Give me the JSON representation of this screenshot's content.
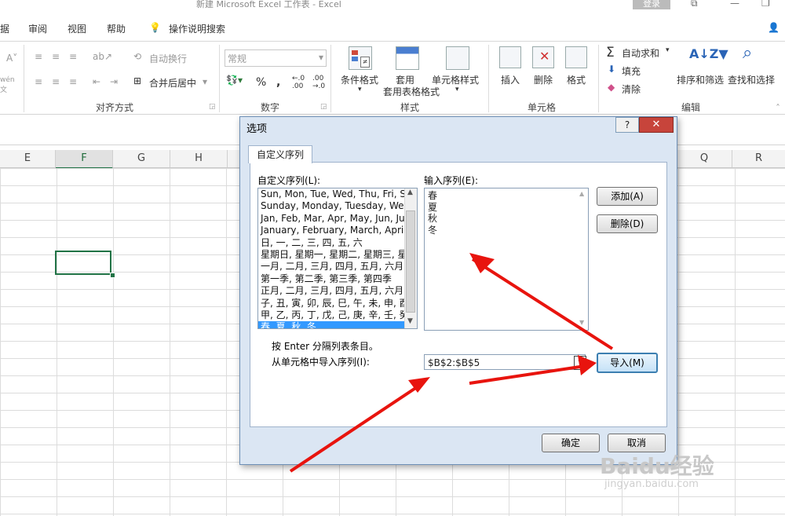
{
  "title_bar": {
    "title": "新建 Microsoft Excel 工作表 - Excel",
    "login_label": "登录"
  },
  "ribbon_tabs": [
    "据",
    "审阅",
    "视图",
    "帮助",
    "操作说明搜索"
  ],
  "ribbon": {
    "alignment": {
      "wrap_label": "自动换行",
      "merge_label": "合并后居中",
      "group_label": "对齐方式"
    },
    "number": {
      "format_value": "常规",
      "percent": "%",
      "comma": ",",
      "group_label": "数字"
    },
    "styles": {
      "conditional_label": "条件格式",
      "table_label": "套用表格格式",
      "cell_styles_label": "单元格样式",
      "group_label": "样式"
    },
    "cells": {
      "insert_label": "插入",
      "delete_label": "删除",
      "format_label": "格式",
      "group_label": "单元格"
    },
    "editing": {
      "autosum_label": "自动求和",
      "fill_label": "填充",
      "clear_label": "清除",
      "sort_label": "排序和筛选",
      "find_label": "查找和选择",
      "group_label": "编辑"
    }
  },
  "columns": [
    "E",
    "F",
    "G",
    "H",
    "Q",
    "R"
  ],
  "dialog": {
    "title": "选项",
    "help_label": "?",
    "close_label": "✕",
    "tab_label": "自定义序列",
    "custom_lists_label": "自定义序列(L):",
    "custom_lists": [
      "Sun, Mon, Tue, Wed, Thu, Fri, S",
      "Sunday, Monday, Tuesday, Wed",
      "Jan, Feb, Mar, Apr, May, Jun, Ju",
      "January, February, March, April",
      "日, 一, 二, 三, 四, 五, 六",
      "星期日, 星期一, 星期二, 星期三, 星",
      "一月, 二月, 三月, 四月, 五月, 六月,",
      "第一季, 第二季, 第三季, 第四季",
      "正月, 二月, 三月, 四月, 五月, 六月,",
      "子, 丑, 寅, 卯, 辰, 巳, 午, 未, 申, 酉",
      "甲, 乙, 丙, 丁, 戊, 己, 庚, 辛, 壬, 癸",
      "春, 夏, 秋, 冬"
    ],
    "entries_label": "输入序列(E):",
    "entries": [
      "春",
      "夏",
      "秋",
      "冬"
    ],
    "add_label": "添加(A)",
    "delete_label": "删除(D)",
    "hint": "按 Enter 分隔列表条目。",
    "import_label": "从单元格中导入序列(I):",
    "import_value": "$B$2:$B$5",
    "import_button": "导入(M)",
    "ok_label": "确定",
    "cancel_label": "取消"
  },
  "watermark": {
    "text": "Baidu经验",
    "url_text": "jingyan.baidu.com"
  },
  "colors": {
    "accent": "#217346",
    "arrow": "#e8140e",
    "selected_list": "#3399ff"
  }
}
